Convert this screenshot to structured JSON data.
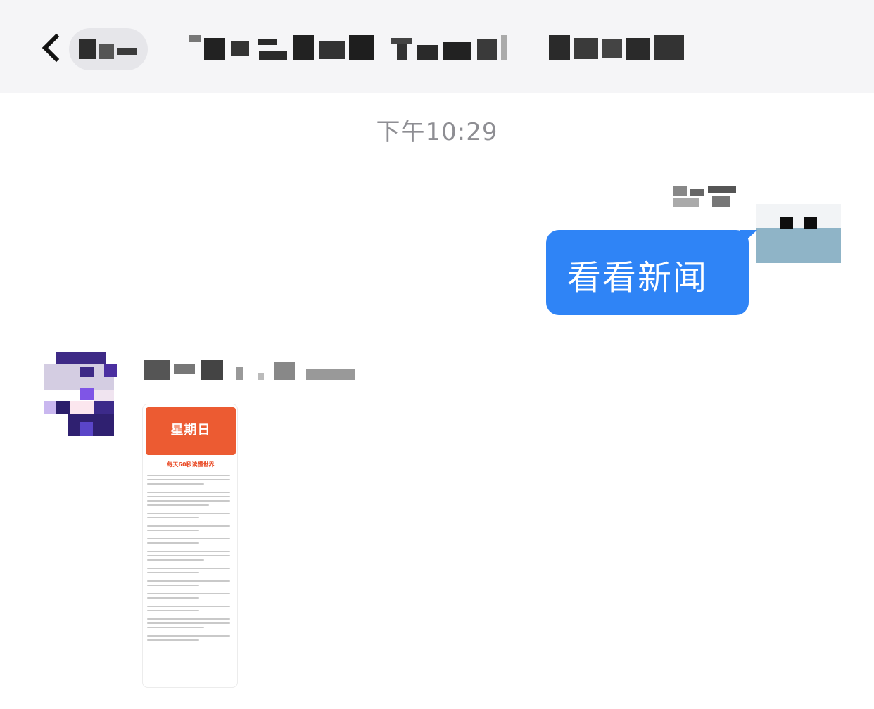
{
  "header": {
    "back_icon": "chevron-left-icon",
    "chat_title": "",
    "title_obscured": true
  },
  "timestamp": "下午10:29",
  "messages": [
    {
      "direction": "outgoing",
      "text": "看看新闻",
      "bubble_color": "#2f84f6",
      "sender_name_obscured": true
    },
    {
      "direction": "incoming",
      "type": "image",
      "sender_name_obscured": true,
      "image": {
        "brand": "",
        "day": "星期日",
        "tagline": "",
        "heading": "每天60秒读懂世界",
        "accent_color": "#ec5b32"
      }
    }
  ],
  "colors": {
    "header_bg": "#f5f5f7",
    "timestamp": "#8e8e93",
    "accent": "#2f84f6"
  }
}
